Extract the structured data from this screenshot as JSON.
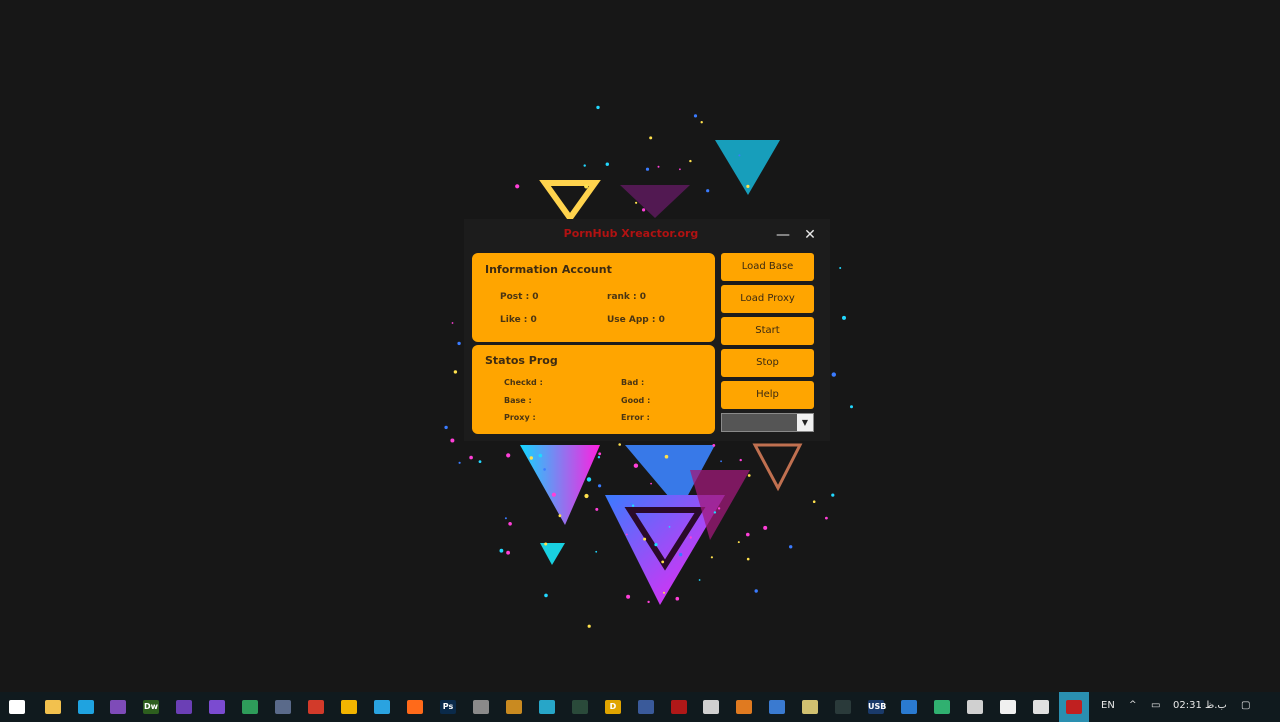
{
  "window": {
    "title": "PornHub Xreactor.org",
    "minimize_glyph": "—",
    "close_glyph": "✕"
  },
  "info_panel": {
    "title": "Information Account",
    "post": "Post : 0",
    "rank": "rank : 0",
    "like": "Like : 0",
    "use_app": "Use App : 0"
  },
  "status_panel": {
    "title": "Statos Prog",
    "checkd": "Checkd :",
    "base": "Base :",
    "proxy": "Proxy :",
    "bad": "Bad :",
    "good": "Good :",
    "error": "Error :"
  },
  "buttons": {
    "load_base": "Load Base",
    "load_proxy": "Load Proxy",
    "start": "Start",
    "stop": "Stop",
    "help": "Help"
  },
  "combo": {
    "value": "",
    "arrow_glyph": "▼"
  },
  "taskbar": {
    "language": "EN",
    "time": "02:31 ب.ظ",
    "icons": [
      {
        "name": "windows-start-icon",
        "color": "#ffffff",
        "label": ""
      },
      {
        "name": "file-explorer-icon",
        "color": "#f2c14e",
        "label": ""
      },
      {
        "name": "edge-icon",
        "color": "#1fa3e0",
        "label": ""
      },
      {
        "name": "tor-browser-icon",
        "color": "#7e4bb8",
        "label": ""
      },
      {
        "name": "dreamweaver-icon",
        "color": "#2d5e1e",
        "label": "Dw"
      },
      {
        "name": "visual-studio-icon",
        "color": "#6b3fb5",
        "label": ""
      },
      {
        "name": "visual-studio-code-icon",
        "color": "#7b4bd0",
        "label": ""
      },
      {
        "name": "edge-dev-icon",
        "color": "#2e9c5a",
        "label": ""
      },
      {
        "name": "app-icon",
        "color": "#5a6a8a",
        "label": ""
      },
      {
        "name": "office-icon",
        "color": "#d23a2a",
        "label": ""
      },
      {
        "name": "chrome-icon",
        "color": "#f2b400",
        "label": ""
      },
      {
        "name": "telegram-icon",
        "color": "#2aa3e0",
        "label": ""
      },
      {
        "name": "firefox-icon",
        "color": "#ff6a1a",
        "label": ""
      },
      {
        "name": "photoshop-icon",
        "color": "#0a2a4a",
        "label": "Ps"
      },
      {
        "name": "virtual-desktop-icon",
        "color": "#8a8a8a",
        "label": ""
      },
      {
        "name": "app-icon",
        "color": "#c98a20",
        "label": ""
      },
      {
        "name": "app-icon",
        "color": "#27a6c8",
        "label": ""
      },
      {
        "name": "shield-icon",
        "color": "#2a4a3a",
        "label": ""
      },
      {
        "name": "app-icon",
        "color": "#e0a400",
        "label": "D"
      },
      {
        "name": "app-icon",
        "color": "#3a5a9a",
        "label": ""
      },
      {
        "name": "spider-icon",
        "color": "#b01818",
        "label": ""
      },
      {
        "name": "record-icon",
        "color": "#d0d0d0",
        "label": ""
      },
      {
        "name": "app-icon",
        "color": "#e07a20",
        "label": ""
      },
      {
        "name": "app-icon",
        "color": "#3a7ad0",
        "label": ""
      },
      {
        "name": "pen-icon",
        "color": "#d0c070",
        "label": ""
      },
      {
        "name": "app-icon",
        "color": "#2a3a3a",
        "label": ""
      },
      {
        "name": "usb-util-icon",
        "color": "#1a3a6a",
        "label": "USB"
      },
      {
        "name": "app-icon",
        "color": "#2a7ad0",
        "label": ""
      },
      {
        "name": "app-icon",
        "color": "#30b070",
        "label": ""
      },
      {
        "name": "app-icon",
        "color": "#d0d0d0",
        "label": ""
      },
      {
        "name": "document-icon",
        "color": "#f0f0f0",
        "label": ""
      },
      {
        "name": "gear-icon",
        "color": "#e0e0e0",
        "label": ""
      },
      {
        "name": "app-icon",
        "color": "#c02020",
        "label": ""
      }
    ]
  }
}
